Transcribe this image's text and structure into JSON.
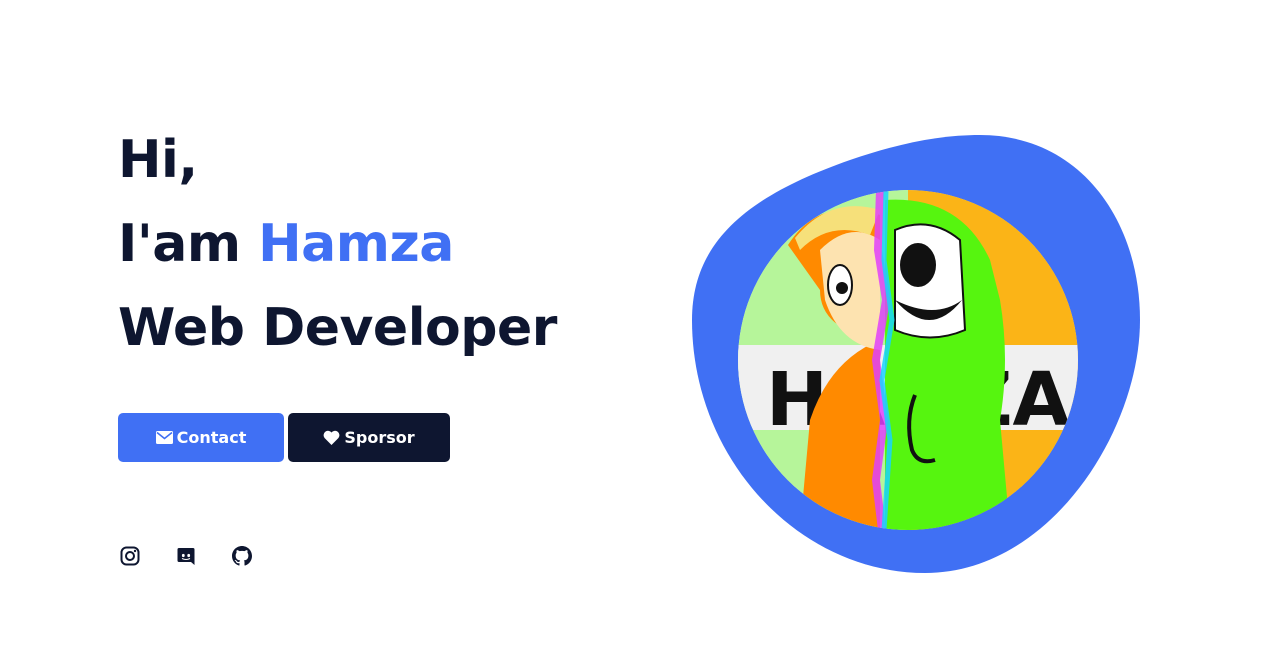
{
  "hero": {
    "greeting": "Hi,",
    "intro_prefix": "I'am ",
    "name": "Hamza",
    "role": "Web Developer"
  },
  "buttons": {
    "contact_label": "Contact",
    "sponsor_label": "Sporsor"
  },
  "socials": [
    {
      "icon": "instagram-icon"
    },
    {
      "icon": "discord-icon"
    },
    {
      "icon": "github-icon"
    }
  ],
  "avatar": {
    "banner_text": "HAMZA"
  },
  "colors": {
    "accent": "#4070f4",
    "dark": "#0e1630",
    "background": "#ffffff"
  }
}
